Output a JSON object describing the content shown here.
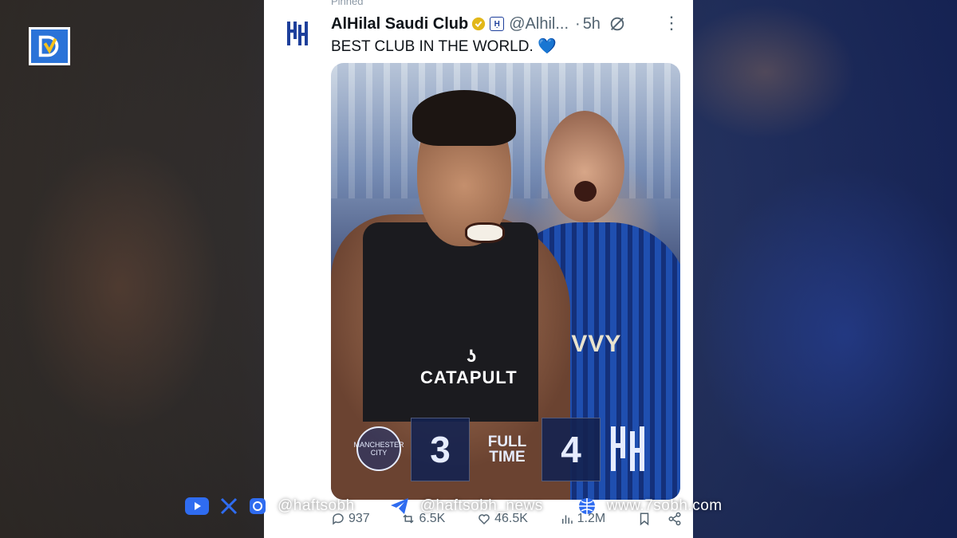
{
  "tweet": {
    "pinned_label": "Pinned",
    "author_name": "AlHilal Saudi Club",
    "handle": "@Alhil...",
    "separator": "·",
    "time": "5h",
    "more": "⋮",
    "text": "BEST CLUB IN THE WORLD.",
    "emoji": "💙"
  },
  "media": {
    "sponsor_front": "CATAPULT",
    "sponsor_back": "IVVY",
    "score_home": "3",
    "score_away": "4",
    "status_line1": "FULL",
    "status_line2": "TIME",
    "home_crest_text": "MANCHESTER CITY"
  },
  "actions": {
    "replies": "937",
    "reposts": "6.5K",
    "likes": "46.5K",
    "views": "1.2M"
  },
  "overlay": {
    "instagram_handle": "@haftsobh",
    "telegram_handle": "@haftsobh_news",
    "website": "www.7sobh.com"
  },
  "colors": {
    "accent": "#1d9bf0",
    "hilal_blue": "#1d3f9b",
    "verified_gold": "#e2b719"
  }
}
